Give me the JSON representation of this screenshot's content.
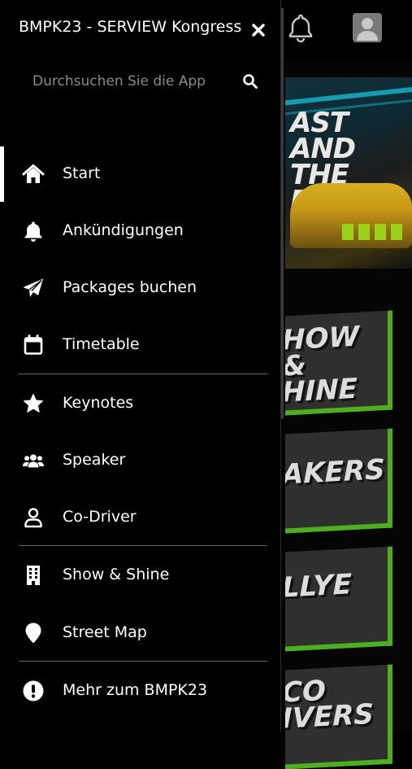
{
  "drawer": {
    "title": "BMPK23 - SERVIEW Kongress",
    "search_placeholder": "Durchsuchen Sie die App",
    "items": [
      {
        "label": "Start",
        "icon": "home-icon",
        "active": true
      },
      {
        "label": "Ankündigungen",
        "icon": "bell-icon"
      },
      {
        "label": "Packages buchen",
        "icon": "paper-plane-icon"
      },
      {
        "label": "Timetable",
        "icon": "calendar-icon"
      },
      {
        "label": "Keynotes",
        "icon": "star-icon"
      },
      {
        "label": "Speaker",
        "icon": "users-icon"
      },
      {
        "label": "Co-Driver",
        "icon": "user-icon"
      },
      {
        "label": "Show & Shine",
        "icon": "building-icon"
      },
      {
        "label": "Street Map",
        "icon": "map-marker-icon"
      },
      {
        "label": "Mehr zum BMPK23",
        "icon": "exclamation-circle-icon"
      }
    ]
  },
  "background": {
    "hero_text": "AST\nAND THE\nBLE IT",
    "tiles": [
      "HOW &\nHINE",
      "AKERS",
      "LLYE",
      "CO\nIVERS"
    ]
  },
  "colors": {
    "background": "#000000",
    "text": "#ffffff",
    "placeholder": "#8b8b8b",
    "divider": "#6a6a6a",
    "accent_green": "#4caf1e"
  }
}
